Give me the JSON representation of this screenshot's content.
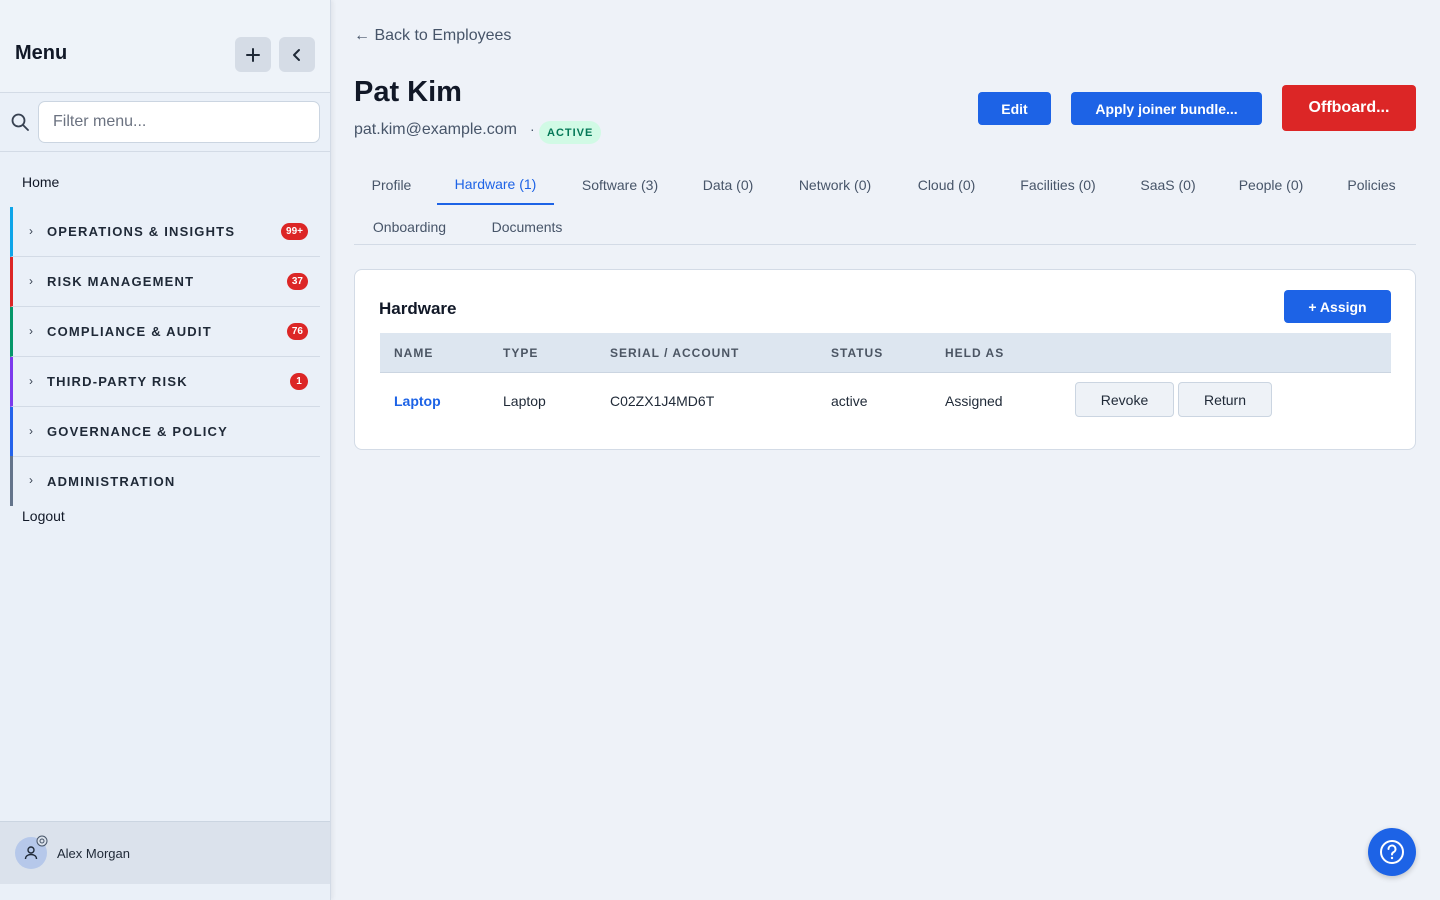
{
  "sidebar": {
    "title": "Menu",
    "add_icon": "plus-icon",
    "collapse_icon": "chevron-left-icon",
    "filter_placeholder": "Filter menu...",
    "home_label": "Home",
    "groups": [
      {
        "label": "OPERATIONS & INSIGHTS",
        "badge": "99+",
        "accent": "#0ea5e9"
      },
      {
        "label": "RISK MANAGEMENT",
        "badge": "37",
        "accent": "#dc2626"
      },
      {
        "label": "COMPLIANCE & AUDIT",
        "badge": "76",
        "accent": "#059669"
      },
      {
        "label": "THIRD-PARTY RISK",
        "badge": "1",
        "accent": "#7c3aed"
      },
      {
        "label": "GOVERNANCE & POLICY",
        "badge": "",
        "accent": "#2563eb"
      },
      {
        "label": "ADMINISTRATION",
        "badge": "",
        "accent": "#64748b"
      }
    ],
    "logout_label": "Logout",
    "user_name": "Alex Morgan"
  },
  "header": {
    "back_link": "← Back to Employees",
    "employee_name": "Pat Kim",
    "email": "pat.kim@example.com",
    "separator": "·",
    "status": "ACTIVE",
    "edit_label": "Edit",
    "joiner_label": "Apply joiner bundle...",
    "offboard_label": "Offboard..."
  },
  "tabs": [
    {
      "label": "Profile",
      "active": false
    },
    {
      "label": "Hardware (1)",
      "active": true
    },
    {
      "label": "Software (3)",
      "active": false
    },
    {
      "label": "Data (0)",
      "active": false
    },
    {
      "label": "Network (0)",
      "active": false
    },
    {
      "label": "Cloud (0)",
      "active": false
    },
    {
      "label": "Facilities (0)",
      "active": false
    },
    {
      "label": "SaaS (0)",
      "active": false
    },
    {
      "label": "People (0)",
      "active": false
    },
    {
      "label": "Policies",
      "active": false
    },
    {
      "label": "Onboarding",
      "active": false
    },
    {
      "label": "Documents",
      "active": false
    }
  ],
  "hardware": {
    "title": "Hardware",
    "assign_label": "+ Assign",
    "columns": [
      "NAME",
      "TYPE",
      "SERIAL / ACCOUNT",
      "STATUS",
      "HELD AS"
    ],
    "rows": [
      {
        "name": "Laptop",
        "type": "Laptop",
        "serial": "C02ZX1J4MD6T",
        "status": "active",
        "held_as": "Assigned",
        "revoke_label": "Revoke",
        "return_label": "Return"
      }
    ]
  },
  "colors": {
    "primary": "#1d63e6",
    "danger": "#dc2626",
    "active_badge_bg": "#d1fae5",
    "active_badge_text": "#047857"
  }
}
